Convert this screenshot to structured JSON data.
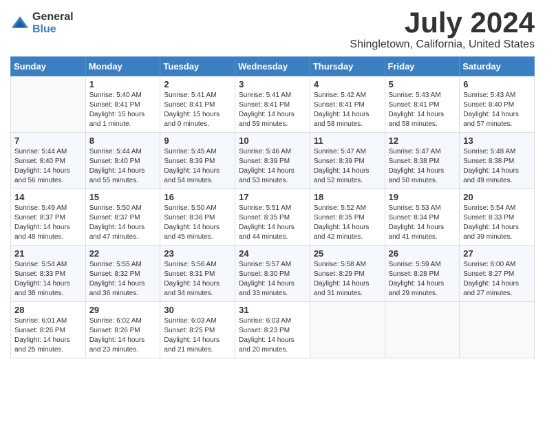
{
  "header": {
    "logo_general": "General",
    "logo_blue": "Blue",
    "month_title": "July 2024",
    "location": "Shingletown, California, United States"
  },
  "columns": [
    "Sunday",
    "Monday",
    "Tuesday",
    "Wednesday",
    "Thursday",
    "Friday",
    "Saturday"
  ],
  "weeks": [
    [
      {
        "day": "",
        "sunrise": "",
        "sunset": "",
        "daylight": ""
      },
      {
        "day": "1",
        "sunrise": "Sunrise: 5:40 AM",
        "sunset": "Sunset: 8:41 PM",
        "daylight": "Daylight: 15 hours and 1 minute."
      },
      {
        "day": "2",
        "sunrise": "Sunrise: 5:41 AM",
        "sunset": "Sunset: 8:41 PM",
        "daylight": "Daylight: 15 hours and 0 minutes."
      },
      {
        "day": "3",
        "sunrise": "Sunrise: 5:41 AM",
        "sunset": "Sunset: 8:41 PM",
        "daylight": "Daylight: 14 hours and 59 minutes."
      },
      {
        "day": "4",
        "sunrise": "Sunrise: 5:42 AM",
        "sunset": "Sunset: 8:41 PM",
        "daylight": "Daylight: 14 hours and 58 minutes."
      },
      {
        "day": "5",
        "sunrise": "Sunrise: 5:43 AM",
        "sunset": "Sunset: 8:41 PM",
        "daylight": "Daylight: 14 hours and 58 minutes."
      },
      {
        "day": "6",
        "sunrise": "Sunrise: 5:43 AM",
        "sunset": "Sunset: 8:40 PM",
        "daylight": "Daylight: 14 hours and 57 minutes."
      }
    ],
    [
      {
        "day": "7",
        "sunrise": "Sunrise: 5:44 AM",
        "sunset": "Sunset: 8:40 PM",
        "daylight": "Daylight: 14 hours and 56 minutes."
      },
      {
        "day": "8",
        "sunrise": "Sunrise: 5:44 AM",
        "sunset": "Sunset: 8:40 PM",
        "daylight": "Daylight: 14 hours and 55 minutes."
      },
      {
        "day": "9",
        "sunrise": "Sunrise: 5:45 AM",
        "sunset": "Sunset: 8:39 PM",
        "daylight": "Daylight: 14 hours and 54 minutes."
      },
      {
        "day": "10",
        "sunrise": "Sunrise: 5:46 AM",
        "sunset": "Sunset: 8:39 PM",
        "daylight": "Daylight: 14 hours and 53 minutes."
      },
      {
        "day": "11",
        "sunrise": "Sunrise: 5:47 AM",
        "sunset": "Sunset: 8:39 PM",
        "daylight": "Daylight: 14 hours and 52 minutes."
      },
      {
        "day": "12",
        "sunrise": "Sunrise: 5:47 AM",
        "sunset": "Sunset: 8:38 PM",
        "daylight": "Daylight: 14 hours and 50 minutes."
      },
      {
        "day": "13",
        "sunrise": "Sunrise: 5:48 AM",
        "sunset": "Sunset: 8:38 PM",
        "daylight": "Daylight: 14 hours and 49 minutes."
      }
    ],
    [
      {
        "day": "14",
        "sunrise": "Sunrise: 5:49 AM",
        "sunset": "Sunset: 8:37 PM",
        "daylight": "Daylight: 14 hours and 48 minutes."
      },
      {
        "day": "15",
        "sunrise": "Sunrise: 5:50 AM",
        "sunset": "Sunset: 8:37 PM",
        "daylight": "Daylight: 14 hours and 47 minutes."
      },
      {
        "day": "16",
        "sunrise": "Sunrise: 5:50 AM",
        "sunset": "Sunset: 8:36 PM",
        "daylight": "Daylight: 14 hours and 45 minutes."
      },
      {
        "day": "17",
        "sunrise": "Sunrise: 5:51 AM",
        "sunset": "Sunset: 8:35 PM",
        "daylight": "Daylight: 14 hours and 44 minutes."
      },
      {
        "day": "18",
        "sunrise": "Sunrise: 5:52 AM",
        "sunset": "Sunset: 8:35 PM",
        "daylight": "Daylight: 14 hours and 42 minutes."
      },
      {
        "day": "19",
        "sunrise": "Sunrise: 5:53 AM",
        "sunset": "Sunset: 8:34 PM",
        "daylight": "Daylight: 14 hours and 41 minutes."
      },
      {
        "day": "20",
        "sunrise": "Sunrise: 5:54 AM",
        "sunset": "Sunset: 8:33 PM",
        "daylight": "Daylight: 14 hours and 39 minutes."
      }
    ],
    [
      {
        "day": "21",
        "sunrise": "Sunrise: 5:54 AM",
        "sunset": "Sunset: 8:33 PM",
        "daylight": "Daylight: 14 hours and 38 minutes."
      },
      {
        "day": "22",
        "sunrise": "Sunrise: 5:55 AM",
        "sunset": "Sunset: 8:32 PM",
        "daylight": "Daylight: 14 hours and 36 minutes."
      },
      {
        "day": "23",
        "sunrise": "Sunrise: 5:56 AM",
        "sunset": "Sunset: 8:31 PM",
        "daylight": "Daylight: 14 hours and 34 minutes."
      },
      {
        "day": "24",
        "sunrise": "Sunrise: 5:57 AM",
        "sunset": "Sunset: 8:30 PM",
        "daylight": "Daylight: 14 hours and 33 minutes."
      },
      {
        "day": "25",
        "sunrise": "Sunrise: 5:58 AM",
        "sunset": "Sunset: 8:29 PM",
        "daylight": "Daylight: 14 hours and 31 minutes."
      },
      {
        "day": "26",
        "sunrise": "Sunrise: 5:59 AM",
        "sunset": "Sunset: 8:28 PM",
        "daylight": "Daylight: 14 hours and 29 minutes."
      },
      {
        "day": "27",
        "sunrise": "Sunrise: 6:00 AM",
        "sunset": "Sunset: 8:27 PM",
        "daylight": "Daylight: 14 hours and 27 minutes."
      }
    ],
    [
      {
        "day": "28",
        "sunrise": "Sunrise: 6:01 AM",
        "sunset": "Sunset: 8:26 PM",
        "daylight": "Daylight: 14 hours and 25 minutes."
      },
      {
        "day": "29",
        "sunrise": "Sunrise: 6:02 AM",
        "sunset": "Sunset: 8:26 PM",
        "daylight": "Daylight: 14 hours and 23 minutes."
      },
      {
        "day": "30",
        "sunrise": "Sunrise: 6:03 AM",
        "sunset": "Sunset: 8:25 PM",
        "daylight": "Daylight: 14 hours and 21 minutes."
      },
      {
        "day": "31",
        "sunrise": "Sunrise: 6:03 AM",
        "sunset": "Sunset: 8:23 PM",
        "daylight": "Daylight: 14 hours and 20 minutes."
      },
      {
        "day": "",
        "sunrise": "",
        "sunset": "",
        "daylight": ""
      },
      {
        "day": "",
        "sunrise": "",
        "sunset": "",
        "daylight": ""
      },
      {
        "day": "",
        "sunrise": "",
        "sunset": "",
        "daylight": ""
      }
    ]
  ]
}
